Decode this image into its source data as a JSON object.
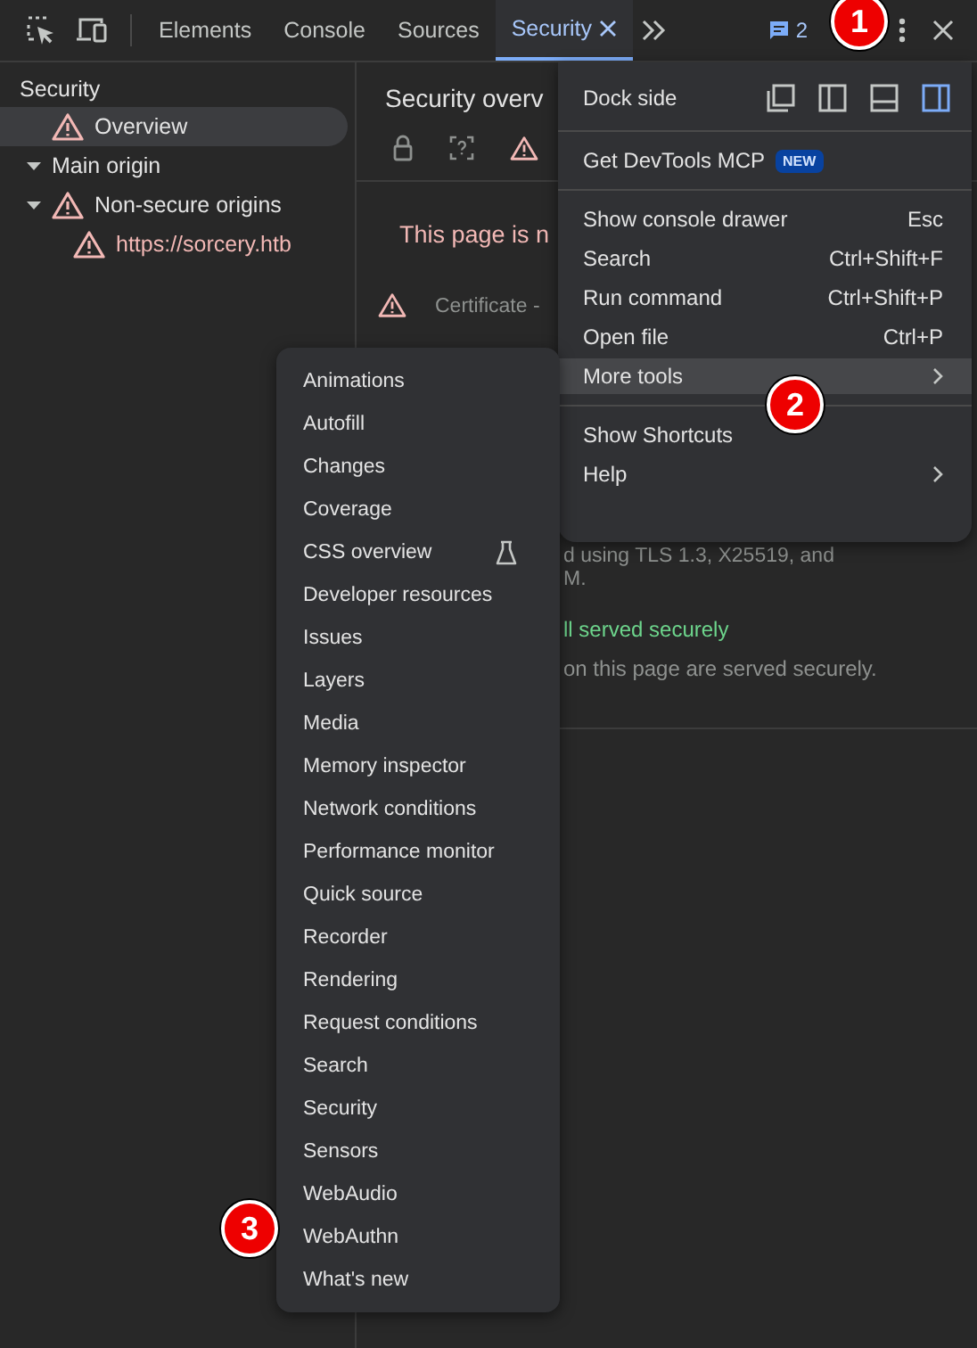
{
  "toolbar": {
    "tabs": [
      {
        "label": "Elements",
        "selected": false
      },
      {
        "label": "Console",
        "selected": false
      },
      {
        "label": "Sources",
        "selected": false
      },
      {
        "label": "Security",
        "selected": true
      }
    ],
    "issues_count": "2"
  },
  "sidebar": {
    "heading": "Security",
    "items": [
      {
        "label": "Overview",
        "warning": true,
        "selected": true
      },
      {
        "label": "Main origin",
        "warning": false,
        "selected": false,
        "expanded": true
      },
      {
        "label": "Non-secure origins",
        "warning": true,
        "selected": false,
        "expanded": true,
        "children": [
          {
            "label": "https://sorcery.htb",
            "warning": true,
            "selected": false
          }
        ]
      }
    ]
  },
  "main": {
    "title": "Security overv",
    "summary": "This page is n",
    "certificate_title": "Certificate - ",
    "connection_lines": [
      "d using TLS 1.3, X25519, and",
      "M."
    ],
    "resources_title": "ll served securely",
    "resources_text": "on this page are served securely."
  },
  "menu": {
    "dock_label": "Dock side",
    "dock_options": [
      {
        "selected": false
      },
      {
        "selected": false
      },
      {
        "selected": false
      },
      {
        "selected": true
      }
    ],
    "items": [
      {
        "kind": "separator"
      },
      {
        "kind": "item",
        "label": "Get DevTools MCP",
        "badge": "NEW"
      },
      {
        "kind": "separator"
      },
      {
        "kind": "item",
        "label": "Show console drawer",
        "shortcut": "Esc"
      },
      {
        "kind": "item",
        "label": "Search",
        "shortcut": "Ctrl+Shift+F"
      },
      {
        "kind": "item",
        "label": "Run command",
        "shortcut": "Ctrl+Shift+P"
      },
      {
        "kind": "item",
        "label": "Open file",
        "shortcut": "Ctrl+P"
      },
      {
        "kind": "submenu",
        "label": "More tools",
        "highlighted": true
      },
      {
        "kind": "separator"
      },
      {
        "kind": "item",
        "label": "Show Shortcuts"
      },
      {
        "kind": "submenu",
        "label": "Help",
        "highlighted": false
      }
    ]
  },
  "submenu": {
    "items": [
      {
        "label": "Animations"
      },
      {
        "label": "Autofill"
      },
      {
        "label": "Changes"
      },
      {
        "label": "Coverage"
      },
      {
        "label": "CSS overview",
        "experimental": true
      },
      {
        "label": "Developer resources"
      },
      {
        "label": "Issues"
      },
      {
        "label": "Layers"
      },
      {
        "label": "Media"
      },
      {
        "label": "Memory inspector"
      },
      {
        "label": "Network conditions"
      },
      {
        "label": "Performance monitor"
      },
      {
        "label": "Quick source"
      },
      {
        "label": "Recorder"
      },
      {
        "label": "Rendering"
      },
      {
        "label": "Request conditions"
      },
      {
        "label": "Search"
      },
      {
        "label": "Security"
      },
      {
        "label": "Sensors"
      },
      {
        "label": "WebAudio"
      },
      {
        "label": "WebAuthn"
      },
      {
        "label": "What's new"
      }
    ]
  },
  "annotations": [
    {
      "label": "1"
    },
    {
      "label": "2"
    },
    {
      "label": "3"
    }
  ]
}
